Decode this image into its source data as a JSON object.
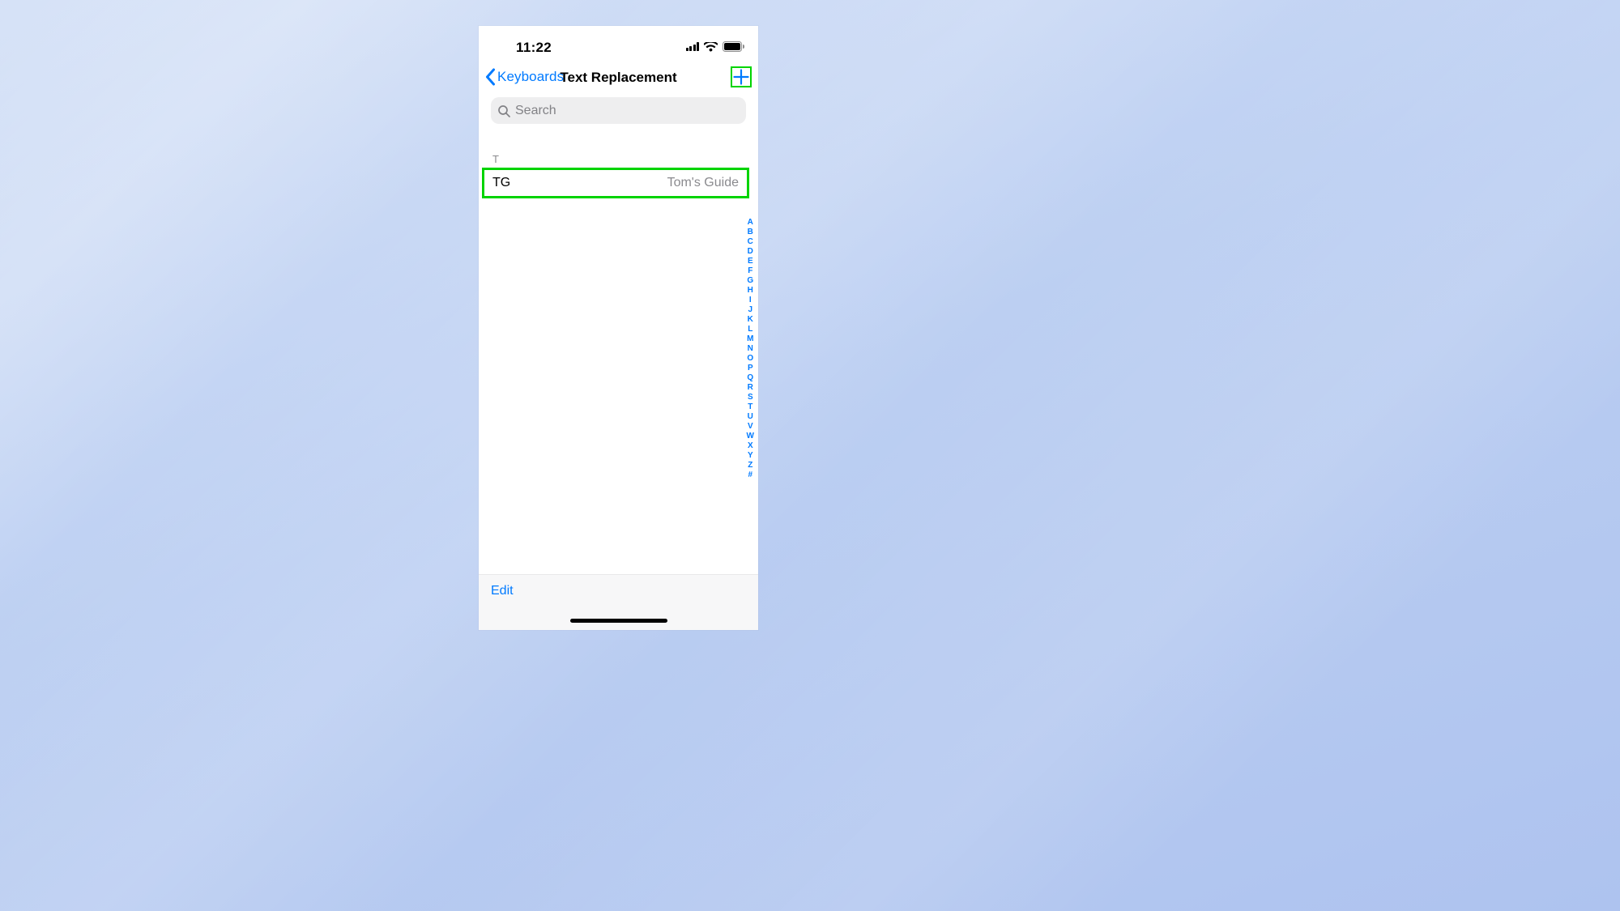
{
  "status": {
    "time": "11:22"
  },
  "nav": {
    "back_label": "Keyboards",
    "title": "Text Replacement"
  },
  "search": {
    "placeholder": "Search"
  },
  "section": {
    "letter": "T",
    "entries": [
      {
        "shortcut": "TG",
        "phrase": "Tom's Guide"
      }
    ]
  },
  "index": [
    "A",
    "B",
    "C",
    "D",
    "E",
    "F",
    "G",
    "H",
    "I",
    "J",
    "K",
    "L",
    "M",
    "N",
    "O",
    "P",
    "Q",
    "R",
    "S",
    "T",
    "U",
    "V",
    "W",
    "X",
    "Y",
    "Z",
    "#"
  ],
  "toolbar": {
    "edit_label": "Edit"
  }
}
